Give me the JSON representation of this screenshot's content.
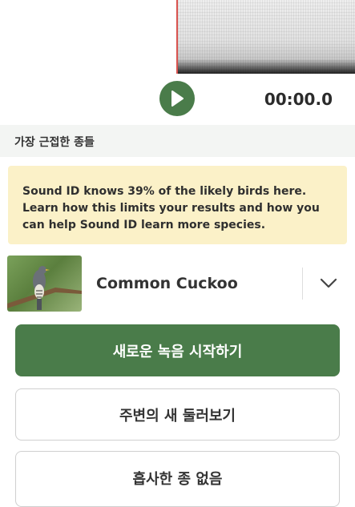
{
  "player": {
    "time": "00:00.0",
    "play_icon": "play-icon"
  },
  "section": {
    "title": "가장 근접한 종들"
  },
  "notice": {
    "line1": "Sound ID knows 39% of the likely birds here.",
    "line2": "Learn how this limits your results and how you",
    "line3": "can help Sound ID learn more species."
  },
  "species": {
    "name": "Common Cuckoo",
    "expand_icon": "chevron-down-icon"
  },
  "actions": {
    "new_recording": "새로운 녹음 시작하기",
    "explore_nearby": "주변의 새 둘러보기",
    "no_similar": "흡사한 종 없음"
  },
  "colors": {
    "primary": "#4a7c4a",
    "notice_bg": "#fbf1c8",
    "section_bg": "#f3f5f3",
    "playhead": "#d9534f"
  }
}
